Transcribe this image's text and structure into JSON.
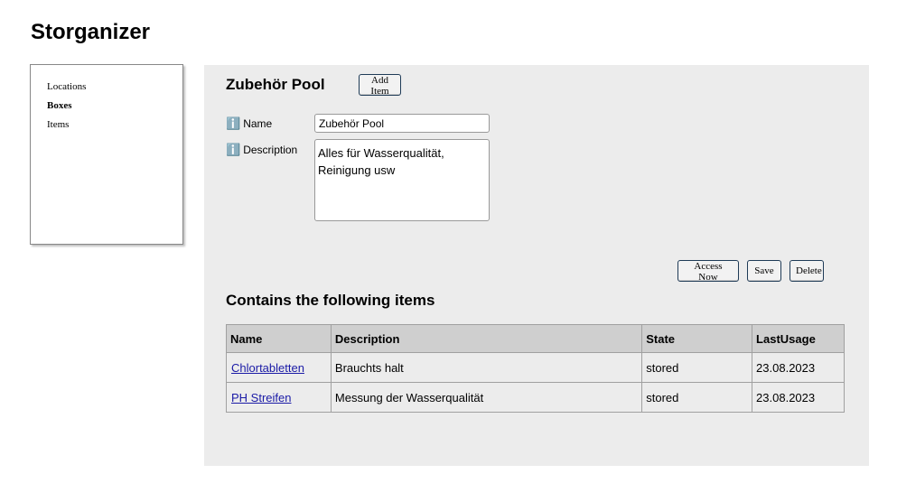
{
  "app": {
    "title": "Storganizer"
  },
  "sidebar": {
    "items": [
      {
        "label": "Locations",
        "active": false
      },
      {
        "label": "Boxes",
        "active": true
      },
      {
        "label": "Items",
        "active": false
      }
    ]
  },
  "box": {
    "title": "Zubehör Pool",
    "add_item_label": "Add Item",
    "info_icon": "ℹ️",
    "name_label": "Name",
    "name_value": "Zubehör Pool",
    "description_label": "Description",
    "description_value": "Alles für Wasserqualität, Reinigung usw"
  },
  "actions": {
    "access_now": "Access Now",
    "save": "Save",
    "delete": "Delete"
  },
  "items_section": {
    "heading": "Contains the following items",
    "columns": [
      "Name",
      "Description",
      "State",
      "LastUsage"
    ],
    "rows": [
      {
        "name": "Chlortabletten",
        "description": "Brauchts halt",
        "state": "stored",
        "last_usage": "23.08.2023"
      },
      {
        "name": "PH Streifen",
        "description": "Messung der Wasserqualität",
        "state": "stored",
        "last_usage": "23.08.2023"
      }
    ]
  }
}
